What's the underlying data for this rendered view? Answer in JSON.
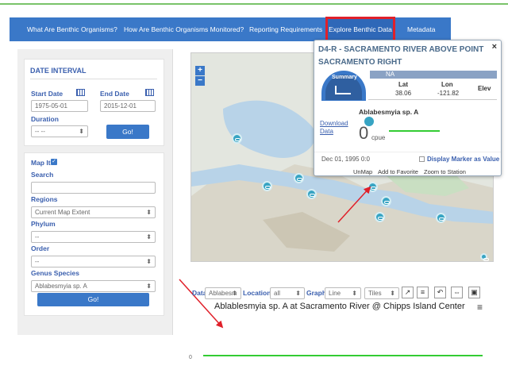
{
  "nav": {
    "items": [
      "What Are Benthic Organisms?",
      "How Are Benthic Organisms Monitored?",
      "Reporting Requirements",
      "Explore Benthic Data",
      "Metadata"
    ]
  },
  "date_interval": {
    "title": "DATE INTERVAL",
    "start_label": "Start Date",
    "end_label": "End Date",
    "start_value": "1975-05-01",
    "end_value": "2015-12-01",
    "duration_label": "Duration",
    "duration_value": "-- --",
    "go_label": "Go!"
  },
  "filters": {
    "map_it_label": "Map It",
    "search_label": "Search",
    "search_value": "",
    "regions_label": "Regions",
    "regions_value": "Current Map Extent",
    "phylum_label": "Phylum",
    "phylum_value": "--",
    "order_label": "Order",
    "order_value": "--",
    "genus_label": "Genus Species",
    "genus_value": "Ablabesmyia sp. A",
    "go_label": "Go!"
  },
  "map": {
    "zoom_in": "+",
    "zoom_out": "−"
  },
  "popup": {
    "title": "D4-R - SACRAMENTO RIVER ABOVE POINT SACRAMENTO RIGHT",
    "close": "×",
    "summary_label": "Summary",
    "na_label": "NA",
    "lat_label": "Lat",
    "lat_value": "38.06",
    "lon_label": "Lon",
    "lon_value": "-121.82",
    "elev_label": "Elev",
    "species": "Ablabesmyia sp. A",
    "download_label": "Download Data",
    "value": "0",
    "unit": "cpue",
    "date": "Dec 01, 1995 0:0",
    "display_marker_label": "Display Marker as Value",
    "unmap": "UnMap",
    "add_favorite": "Add to Favorite",
    "zoom_station": "Zoom to Station"
  },
  "chart_controls": {
    "data_label": "Data",
    "data_value": "Ablabesm",
    "location_label": "Location",
    "location_value": "all",
    "graph_label": "Graph",
    "graph_value": "Line",
    "tiles_value": "Tiles"
  },
  "chart_data": {
    "type": "line",
    "title": "Ablablesmyia sp. A at Sacramento River @ Chipps Island Center",
    "ytick": "0",
    "series": [
      {
        "values": [
          0,
          0
        ]
      }
    ],
    "line_color": "#33cc33"
  },
  "colors": {
    "nav": "#3a78c8",
    "accent_red": "#e0202a",
    "marker": "#37a4c3",
    "water": "#b8d3e8"
  }
}
